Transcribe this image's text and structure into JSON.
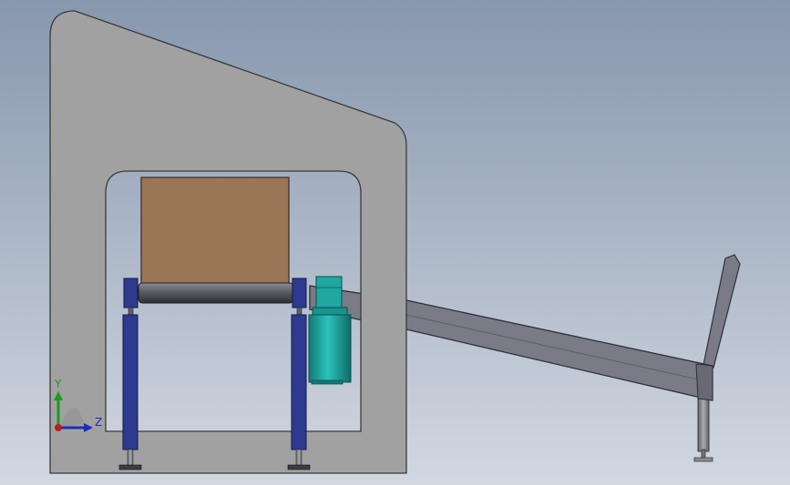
{
  "viewport": {
    "background_top": "#8797ad",
    "background_bottom": "#d2d8e2"
  },
  "colors": {
    "housing": "#a1a1a1",
    "housing_stroke": "#3a3a3a",
    "cavity": "#cfd6e2",
    "hopper": "#9b7656",
    "belt_dark": "#3f4145",
    "belt_light": "#6a6d73",
    "column": "#2e3a8f",
    "column_stroke": "#111a4a",
    "motor": "#1fa7a2",
    "motor_dark": "#137a76",
    "conveyor": "#7a7b87",
    "conveyor_stroke": "#2f3038",
    "foot": "#7f8288"
  },
  "triad": {
    "y_axis_label": "Y",
    "z_axis_label": "Z",
    "y_color": "#1a9b1a",
    "z_color": "#1b2fb8",
    "x_color": "#c21b1b"
  }
}
